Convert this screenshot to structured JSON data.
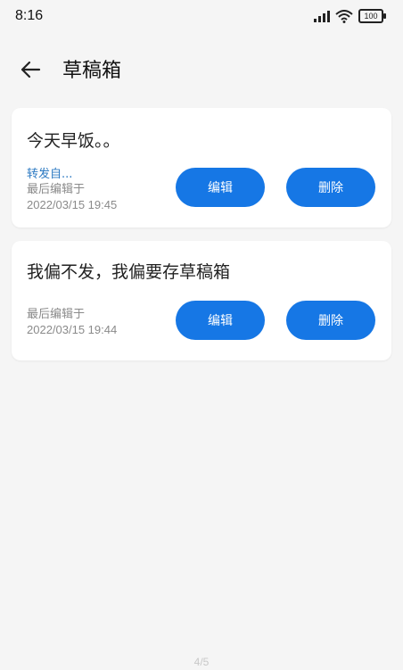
{
  "status_bar": {
    "time": "8:16",
    "battery": "100"
  },
  "header": {
    "title": "草稿箱"
  },
  "drafts": [
    {
      "text": "今天早饭。。",
      "forward_label": "转发自...",
      "meta_label": "最后编辑于",
      "timestamp": "2022/03/15 19:45",
      "edit_label": "编辑",
      "delete_label": "删除"
    },
    {
      "text": "我偏不发，我偏要存草稿箱",
      "meta_label": "最后编辑于",
      "timestamp": "2022/03/15 19:44",
      "edit_label": "编辑",
      "delete_label": "删除"
    }
  ],
  "page_indicator": "4/5",
  "colors": {
    "accent": "#1677e5",
    "link": "#2b79c2",
    "background": "#f5f5f5"
  }
}
